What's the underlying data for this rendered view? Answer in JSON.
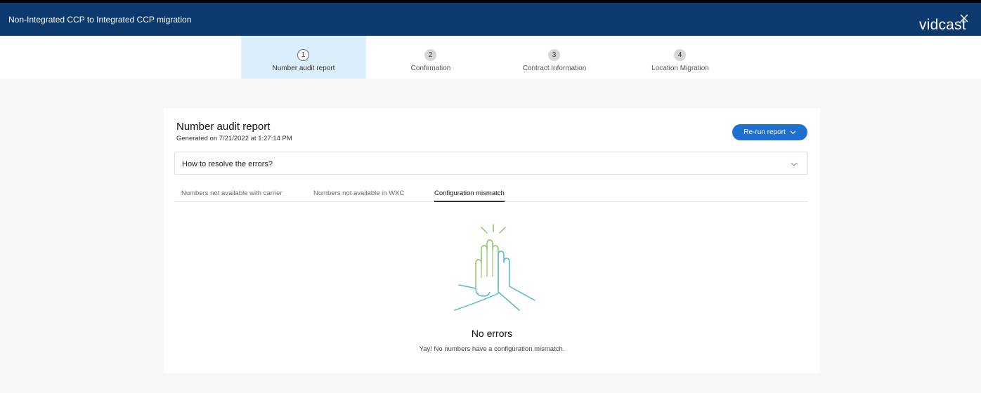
{
  "header": {
    "title": "Non-Integrated CCP to Integrated CCP migration",
    "brand": "vidcast",
    "color": "#0c3a6e"
  },
  "stepper": {
    "steps": [
      {
        "number": "1",
        "label": "Number audit report",
        "active": true
      },
      {
        "number": "2",
        "label": "Confirmation",
        "active": false
      },
      {
        "number": "3",
        "label": "Contract Information",
        "active": false
      },
      {
        "number": "4",
        "label": "Location Migration",
        "active": false
      }
    ]
  },
  "report": {
    "title": "Number audit report",
    "generated": "Generated on 7/21/2022 at 1:27:14 PM",
    "rerun_label": "Re-run report",
    "accordion_label": "How to resolve the errors?",
    "tabs": [
      {
        "label": "Numbers not available with carrier",
        "active": false
      },
      {
        "label": "Numbers not available in WXC",
        "active": false
      },
      {
        "label": "Configuration mismatch",
        "active": true
      }
    ],
    "empty_title": "No errors",
    "empty_message": "Yay! No numbers have a configuration mismatch."
  },
  "colors": {
    "accent": "#1f6fd1",
    "active_step_bg": "#dbeefb",
    "illustration_green": "#8cc769",
    "illustration_blue": "#5ab4d6"
  }
}
